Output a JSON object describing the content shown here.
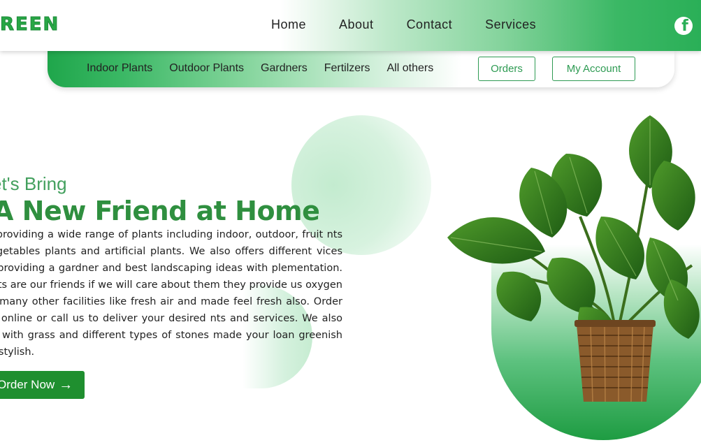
{
  "header": {
    "logo": "REEN",
    "nav": [
      "Home",
      "About",
      "Contact",
      "Services"
    ],
    "facebook_icon": "facebook-icon"
  },
  "subnav": {
    "items": [
      "Indoor Plants",
      "Outdoor Plants",
      "Gardners",
      "Fertilzers",
      "All others"
    ],
    "orders_label": "Orders",
    "account_label": "My Account"
  },
  "hero": {
    "subtitle": "et's Bring",
    "title": "A New Friend at Home",
    "paragraph": "are providing a wide range of plants including indoor, outdoor, fruit nts , vegetables plants and artificial plants. We also offers different vices like providing a gardner and best landscaping ideas with plementation. Plants are our friends if we will care about them they provide us oxygen and many other facilities like fresh air and made feel fresh also. Order now online or call us to deliver your desired nts and services. We also deal with grass and different types of stones made your loan greenish and stylish.",
    "button_label": "Order Now",
    "button_icon": "arrow-right-icon"
  },
  "colors": {
    "brand_green": "#2f8f3f",
    "button_green": "#1f8f2f",
    "accent_light": "#c3ebcf"
  }
}
